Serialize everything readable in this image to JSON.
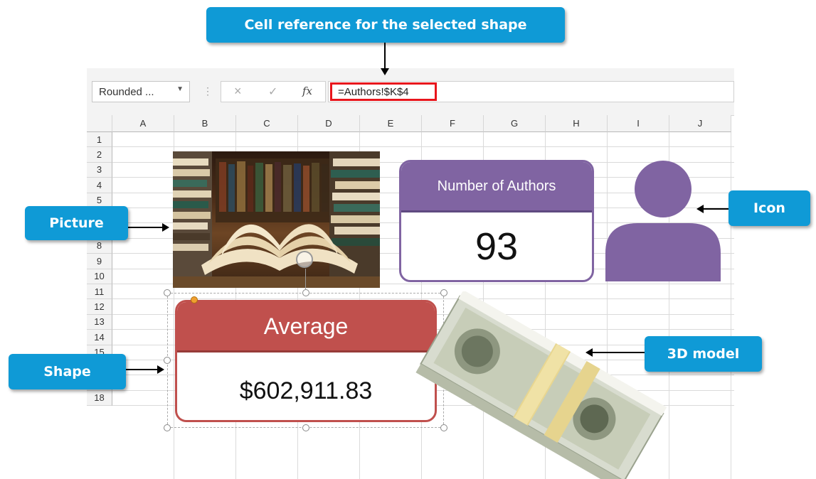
{
  "callouts": {
    "cell_reference": "Cell reference for the selected shape",
    "picture": "Picture",
    "icon": "Icon",
    "shape": "Shape",
    "model3d": "3D model"
  },
  "formula_bar": {
    "name_box": "Rounded ...",
    "cancel_symbol": "×",
    "enter_symbol": "✓",
    "fx_label": "fx",
    "formula": "=Authors!$K$4"
  },
  "columns": [
    "A",
    "B",
    "C",
    "D",
    "E",
    "F",
    "G",
    "H",
    "I",
    "J"
  ],
  "rows": [
    "1",
    "2",
    "3",
    "4",
    "5",
    "6",
    "7",
    "8",
    "9",
    "10",
    "11",
    "12",
    "13",
    "14",
    "15",
    "16",
    "17",
    "18"
  ],
  "authors_card": {
    "title": "Number of Authors",
    "value": "93"
  },
  "average_shape": {
    "title": "Average",
    "value": "$602,911.83"
  },
  "colors": {
    "callout_blue": "#0f9ad6",
    "purple": "#8064a2",
    "red": "#c0504d",
    "highlight": "#e8151c"
  },
  "icons": {
    "books_picture": "open-book-photo",
    "person": "person-icon",
    "money": "money-stack-3d-model"
  }
}
